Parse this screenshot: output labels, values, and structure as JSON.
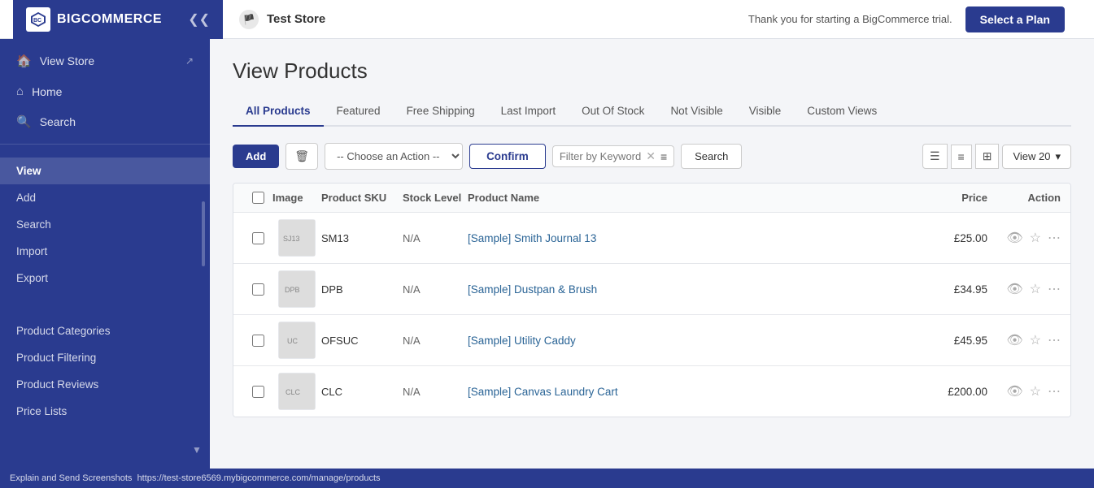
{
  "topbar": {
    "logo_text": "BIGCOMMERCE",
    "store_name": "Test Store",
    "trial_message": "Thank you for starting a BigCommerce trial.",
    "select_plan_label": "Select a Plan"
  },
  "sidebar": {
    "nav_top": [
      {
        "label": "View Store",
        "icon": "🏠",
        "ext": true
      },
      {
        "label": "Home",
        "icon": "⌂",
        "ext": false
      },
      {
        "label": "Search",
        "icon": "🔍",
        "ext": false
      }
    ],
    "products_section": {
      "items": [
        {
          "label": "View",
          "active": true
        },
        {
          "label": "Add"
        },
        {
          "label": "Search"
        },
        {
          "label": "Import"
        },
        {
          "label": "Export"
        }
      ]
    },
    "catalog_section": {
      "items": [
        {
          "label": "Product Categories"
        },
        {
          "label": "Product Filtering"
        },
        {
          "label": "Product Reviews"
        },
        {
          "label": "Price Lists"
        }
      ]
    }
  },
  "main": {
    "page_title": "View Products",
    "tabs": [
      {
        "label": "All Products",
        "active": true
      },
      {
        "label": "Featured"
      },
      {
        "label": "Free Shipping"
      },
      {
        "label": "Last Import"
      },
      {
        "label": "Out Of Stock"
      },
      {
        "label": "Not Visible"
      },
      {
        "label": "Visible"
      },
      {
        "label": "Custom Views"
      }
    ],
    "toolbar": {
      "add_label": "Add",
      "action_placeholder": "-- Choose an Action --",
      "confirm_label": "Confirm",
      "filter_placeholder": "Filter by Keyword",
      "search_label": "Search",
      "view_count": "View 20"
    },
    "table": {
      "headers": [
        "",
        "Image",
        "Product SKU",
        "Stock Level",
        "Product Name",
        "Price",
        "Action"
      ],
      "rows": [
        {
          "sku": "SM13",
          "stock": "N/A",
          "name": "[Sample] Smith Journal 13",
          "price": "£25.00",
          "img_label": "SJ13"
        },
        {
          "sku": "DPB",
          "stock": "N/A",
          "name": "[Sample] Dustpan & Brush",
          "price": "£34.95",
          "img_label": "DPB"
        },
        {
          "sku": "OFSUC",
          "stock": "N/A",
          "name": "[Sample] Utility Caddy",
          "price": "£45.95",
          "img_label": "UC"
        },
        {
          "sku": "CLC",
          "stock": "N/A",
          "name": "[Sample] Canvas Laundry Cart",
          "price": "£200.00",
          "img_label": "CLC"
        }
      ]
    }
  },
  "statusbar": {
    "url": "https://test-store6569.mybigcommerce.com/manage/products",
    "label": "Explain and Send Screenshots"
  }
}
